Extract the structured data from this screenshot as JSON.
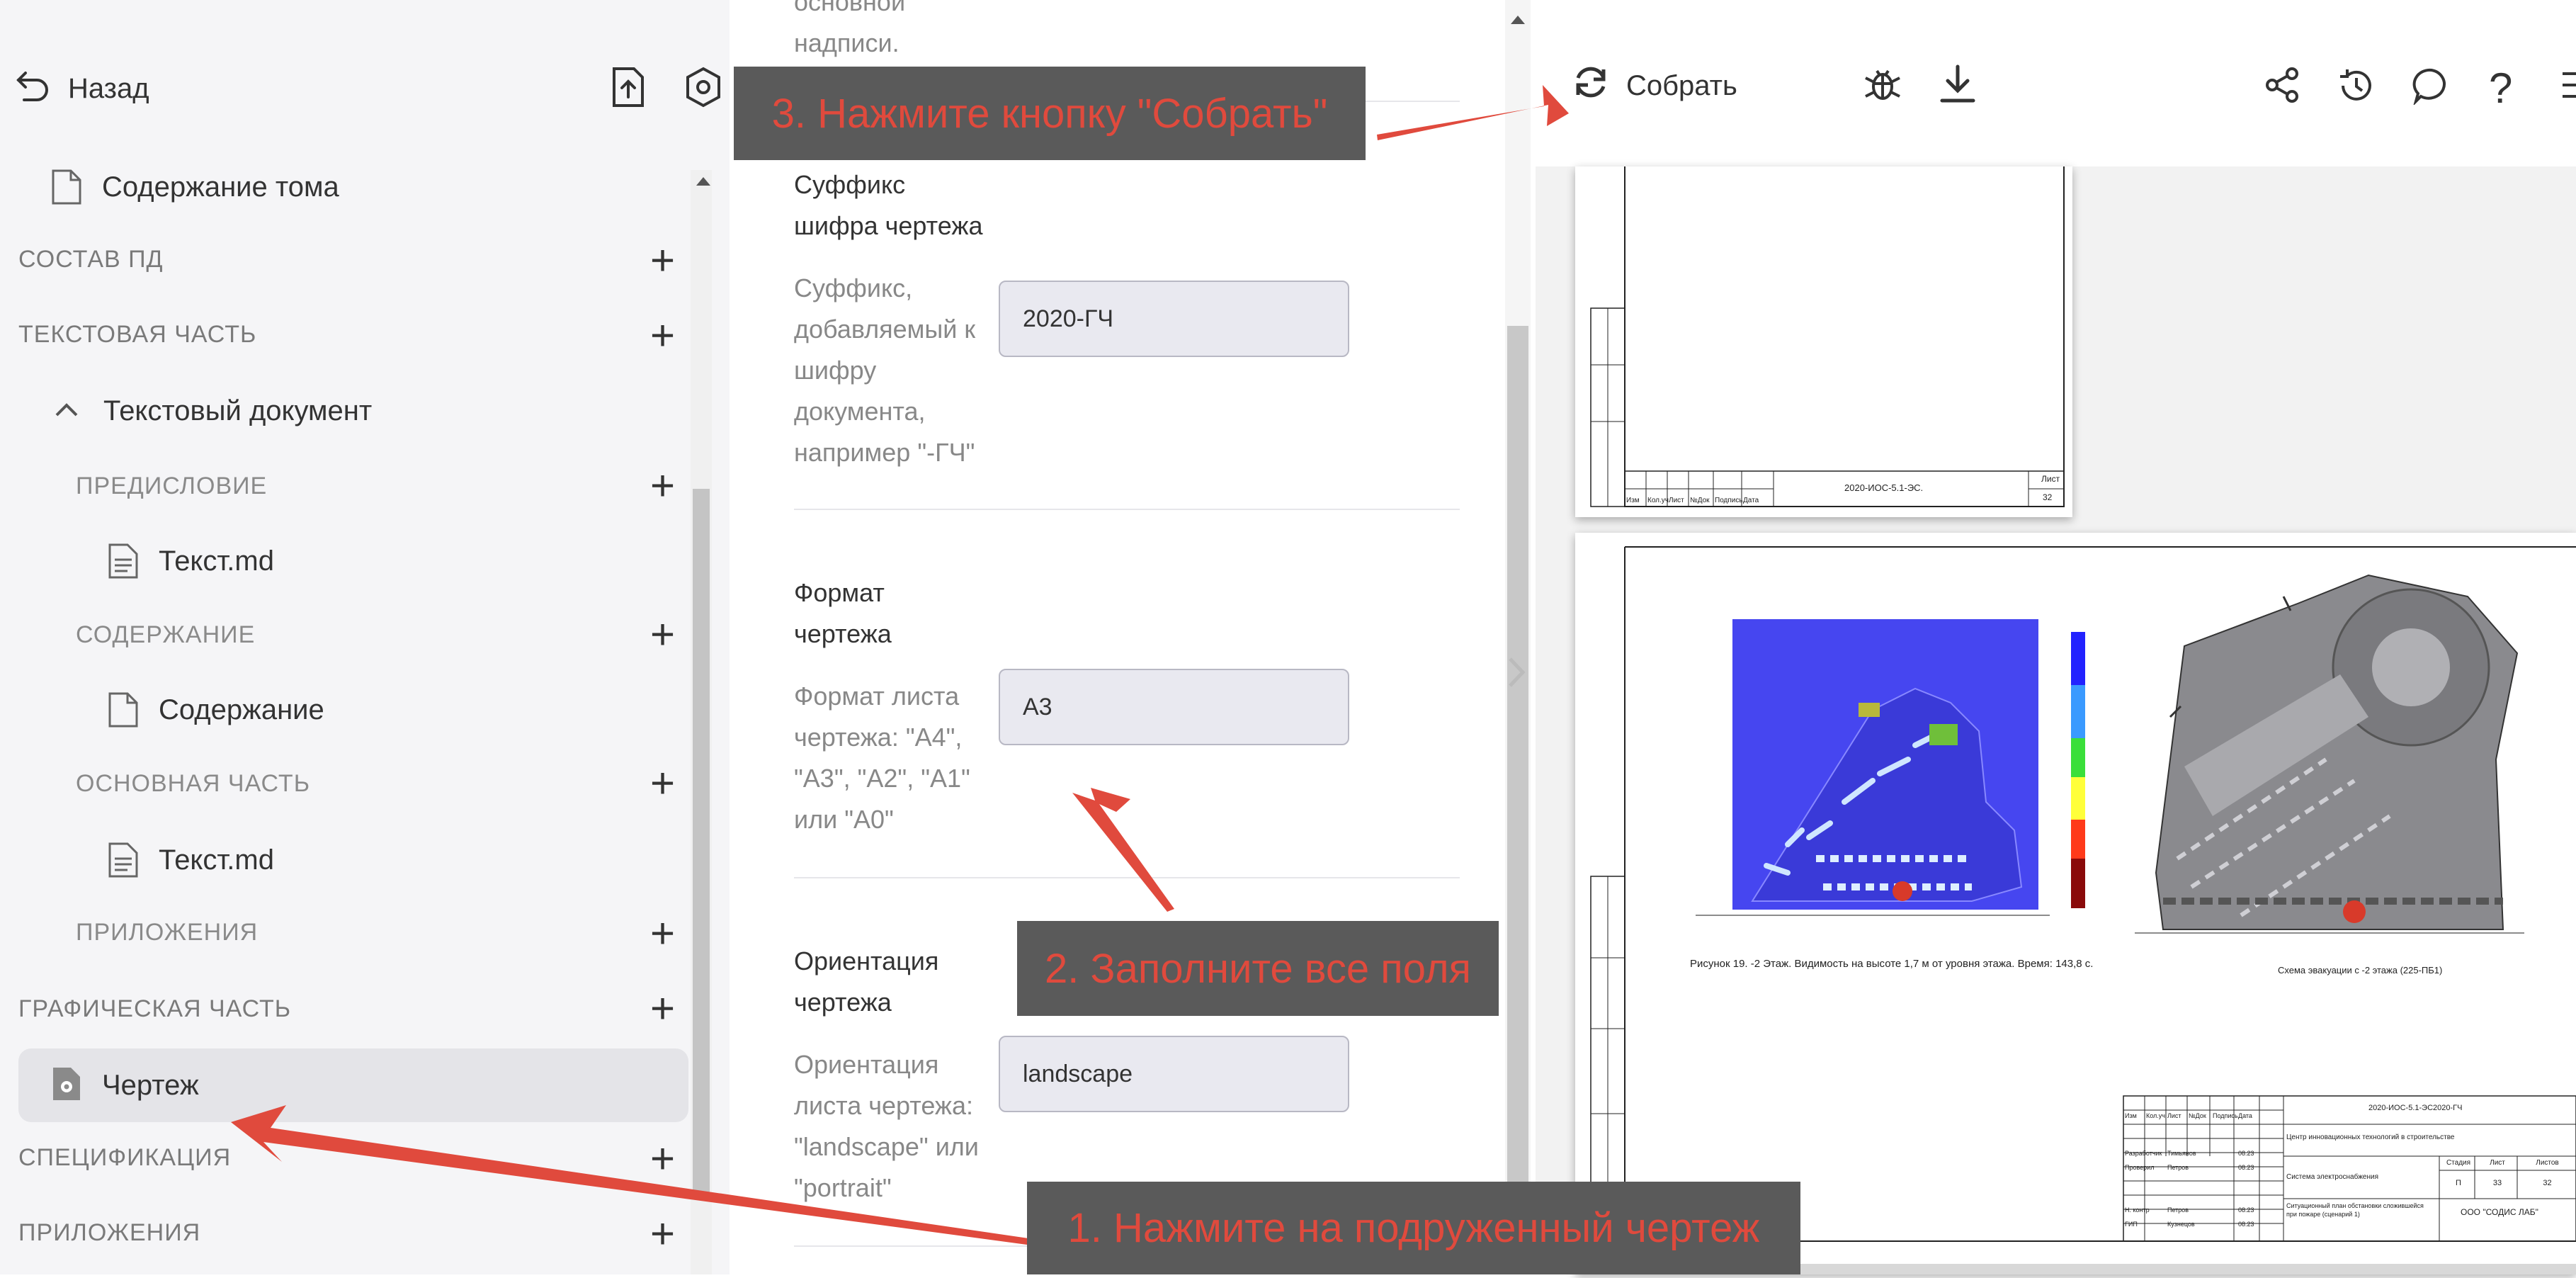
{
  "sidebar": {
    "back_label": "Назад",
    "items": [
      {
        "label": "Содержание тома"
      },
      {
        "label": "СОСТАВ ПД"
      },
      {
        "label": "ТЕКСТОВАЯ ЧАСТЬ"
      },
      {
        "label": "Текстовый документ"
      },
      {
        "label": "ПРЕДИСЛОВИЕ"
      },
      {
        "label": "Текст.md"
      },
      {
        "label": "СОДЕРЖАНИЕ"
      },
      {
        "label": "Содержание"
      },
      {
        "label": "ОСНОВНАЯ ЧАСТЬ"
      },
      {
        "label": "Текст.md"
      },
      {
        "label": "ПРИЛОЖЕНИЯ"
      },
      {
        "label": "ГРАФИЧЕСКАЯ ЧАСТЬ"
      },
      {
        "label": "Чертеж"
      },
      {
        "label": "СПЕЦИФИКАЦИЯ"
      },
      {
        "label": "ПРИЛОЖЕНИЯ"
      }
    ]
  },
  "form": {
    "top_partial": [
      "основной",
      "надписи."
    ],
    "fields": [
      {
        "title": [
          "Суффикс",
          "шифра чертежа"
        ],
        "desc": [
          "Суффикс,",
          "добавляемый к",
          "шифру",
          "документа,",
          "например \"-ГЧ\""
        ],
        "value": "2020-ГЧ"
      },
      {
        "title": [
          "Формат",
          "чертежа"
        ],
        "desc": [
          "Формат листа",
          "чертежа: \"А4\",",
          "\"А3\", \"А2\", \"А1\"",
          "или \"А0\""
        ],
        "value": "А3"
      },
      {
        "title": [
          "Ориентация",
          "чертежа"
        ],
        "desc": [
          "Ориентация",
          "листа чертежа:",
          "\"landscape\" или",
          "\"portrait\""
        ],
        "value": "landscape"
      }
    ]
  },
  "toolbar": {
    "build_label": "Собрать"
  },
  "preview": {
    "sheet1_code": "2020-ИОС-5.1-ЭС.",
    "sheet1_page": "32",
    "sheet1_sheet_label": "Лист",
    "title_block_cols": [
      "Изм",
      "Кол.уч",
      "Лист",
      "№Док",
      "Подпись",
      "Дата"
    ],
    "figure_caption_left": "Рисунок 19. -2 Этаж. Видимость на высоте 1,7 м от уровня этажа. Время: 143,8 с.",
    "figure_caption_right": "Схема эвакуации с -2 этажа (225-ПБ1)",
    "sheet2_code": "2020-ИОС-5.1-ЭС2020-ГЧ",
    "org_center": "Центр инновационных технологий в строительстве",
    "system_name": "Система электроснабжения",
    "plan_name": "Ситуационный план обстановки сложившейся при пожаре (сценарий 1)",
    "company": "ООО \"СОДИС ЛАБ\"",
    "stage_header": [
      "Стадия",
      "Лист",
      "Листов"
    ],
    "stage_values": [
      "П",
      "33",
      "32"
    ],
    "roles": [
      "Разработчик",
      "Проверил",
      "Н. контр",
      "ГИП"
    ],
    "names": [
      "Тимьянов",
      "Петров",
      "Петров",
      "Кузнецов"
    ],
    "dates": [
      "08.23",
      "08.23",
      "08.23",
      "08.23"
    ]
  },
  "annotations": {
    "step1": "1. Нажмите на подруженный чертеж",
    "step2": "2. Заполните все поля",
    "step3": "3. Нажмите кнопку \"Собрать\""
  },
  "colors": {
    "accent_red": "#e04a3d",
    "callout_bg": "#5a5a5a",
    "sidebar_bg": "#f5f5f7",
    "input_bg": "#e9e9f0"
  }
}
